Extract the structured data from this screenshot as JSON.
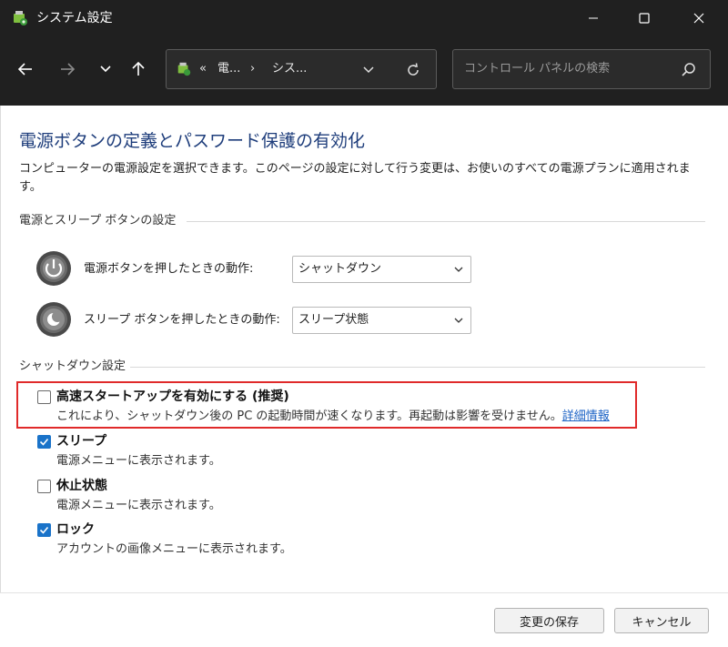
{
  "window": {
    "title": "システム設定"
  },
  "navbar": {
    "breadcrumbs": [
      "«",
      "電...",
      "›",
      "シス..."
    ],
    "search_placeholder": "コントロール パネルの検索"
  },
  "page": {
    "title": "電源ボタンの定義とパスワード保護の有効化",
    "description": "コンピューターの電源設定を選択できます。このページの設定に対して行う変更は、お使いのすべての電源プランに適用されます。"
  },
  "power_section": {
    "heading": "電源とスリープ ボタンの設定",
    "power_button": {
      "label": "電源ボタンを押したときの動作:",
      "value": "シャットダウン"
    },
    "sleep_button": {
      "label": "スリープ ボタンを押したときの動作:",
      "value": "スリープ状態"
    }
  },
  "shutdown_section": {
    "heading": "シャットダウン設定",
    "items": [
      {
        "title": "高速スタートアップを有効にする (推奨)",
        "desc": "これにより、シャットダウン後の PC の起動時間が速くなります。再起動は影響を受けません。",
        "link": "詳細情報",
        "checked": false
      },
      {
        "title": "スリープ",
        "desc": "電源メニューに表示されます。",
        "checked": true
      },
      {
        "title": "休止状態",
        "desc": "電源メニューに表示されます。",
        "checked": false
      },
      {
        "title": "ロック",
        "desc": "アカウントの画像メニューに表示されます。",
        "checked": true
      }
    ]
  },
  "footer": {
    "save_label": "変更の保存",
    "cancel_label": "キャンセル"
  },
  "colors": {
    "accent": "#1a73c9",
    "title_blue": "#1e3d7b",
    "highlight": "#e02a2a",
    "titlebar": "#202020"
  }
}
